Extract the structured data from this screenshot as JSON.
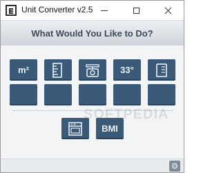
{
  "window": {
    "title": "Unit Converter v2.5"
  },
  "header": {
    "title": "What Would You Like to Do?"
  },
  "tiles": {
    "area_label": "m²",
    "temperature_label": "33°",
    "bmi_label": "BMI"
  },
  "watermark": {
    "text": "SOFTPEDIA"
  },
  "colors": {
    "tile": "#3b5a78",
    "header_text": "#3d4a57"
  }
}
